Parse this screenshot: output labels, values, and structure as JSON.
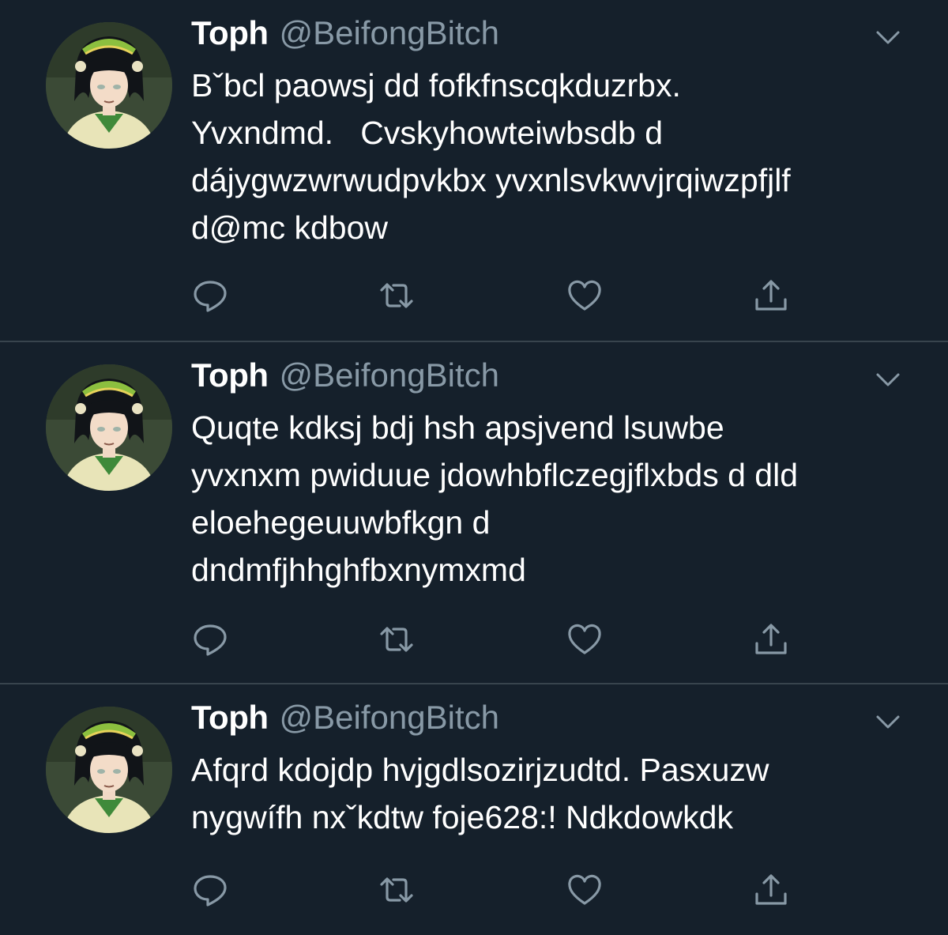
{
  "timeline": {
    "tweets": [
      {
        "name": "Toph",
        "handle": "@BeifongBitch",
        "text": "Bˇbcl paowsj dd fofkfnscqkduzrbx.\nYvxndmd.   Cvskyhowteiwbsdb d\ndájygwzwrwudpvkbx yvxnlsvkwvjrqiwzpfjlf\nd@mc kdbow"
      },
      {
        "name": "Toph",
        "handle": "@BeifongBitch",
        "text": "Quqte kdksj bdj hsh apsjvend lsuwbe\nyvxnxm pwiduue jdowhbflczegjflxbds d dld\neloehegeuuwbfkgn d\ndndmfjhhghfbxnymxmd"
      },
      {
        "name": "Toph",
        "handle": "@BeifongBitch",
        "text": "Afqrd kdojdp hvjgdlsozirjzudtd. Pasxuzw\nnygwífh nxˇkdtw foje628:! Ndkdowkdk"
      }
    ],
    "icons": {
      "more": "chevron-down-icon",
      "reply": "reply-icon",
      "retweet": "retweet-icon",
      "like": "heart-icon",
      "share": "share-icon"
    },
    "colors": {
      "background": "#15202b",
      "divider": "#38444d",
      "text": "#ffffff",
      "secondary": "#8899a6"
    }
  }
}
